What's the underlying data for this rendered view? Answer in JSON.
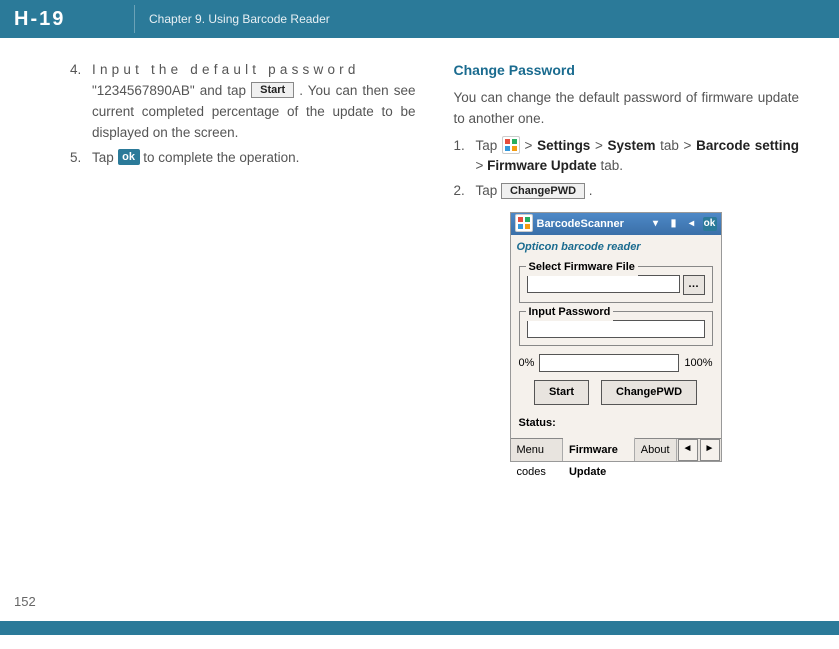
{
  "header": {
    "logo": "H-19",
    "chapter": "Chapter 9. Using Barcode Reader"
  },
  "left": {
    "step4_num": "4.",
    "step4_line1": "Input the default password",
    "step4_line2a": "\"1234567890AB\" and tap ",
    "start_btn": "Start",
    "step4_cont": ". You can then see current completed percentage of the update to be displayed on the screen.",
    "step5_num": "5.",
    "step5_a": "Tap ",
    "ok_btn": "ok",
    "step5_b": " to complete the operation."
  },
  "right": {
    "title": "Change Password",
    "intro": "You can change the default password of firmware update to another one.",
    "step1_num": "1.",
    "step1_a": "Tap ",
    "gt1": " > ",
    "settings": "Settings",
    "gt2": " > ",
    "system": "System",
    "tab_word": " tab > ",
    "barcode_setting": "Barcode setting",
    "gt3": " > ",
    "firmware_update": "Firmware Update",
    "tab_tail": " tab.",
    "step2_num": "2.",
    "step2_a": "Tap ",
    "changepwd_btn": "ChangePWD",
    "step2_b": " ."
  },
  "device": {
    "title": "BarcodeScanner",
    "sub": "Opticon barcode reader",
    "legend1": "Select Firmware File",
    "legend2": "Input Password",
    "pct0": "0%",
    "pct100": "100%",
    "btn_start": "Start",
    "btn_change": "ChangePWD",
    "status": "Status:",
    "tab_menu": "Menu codes",
    "tab_fw": "Firmware Update",
    "tab_about": "About"
  },
  "page_number": "152",
  "chart_data": null
}
